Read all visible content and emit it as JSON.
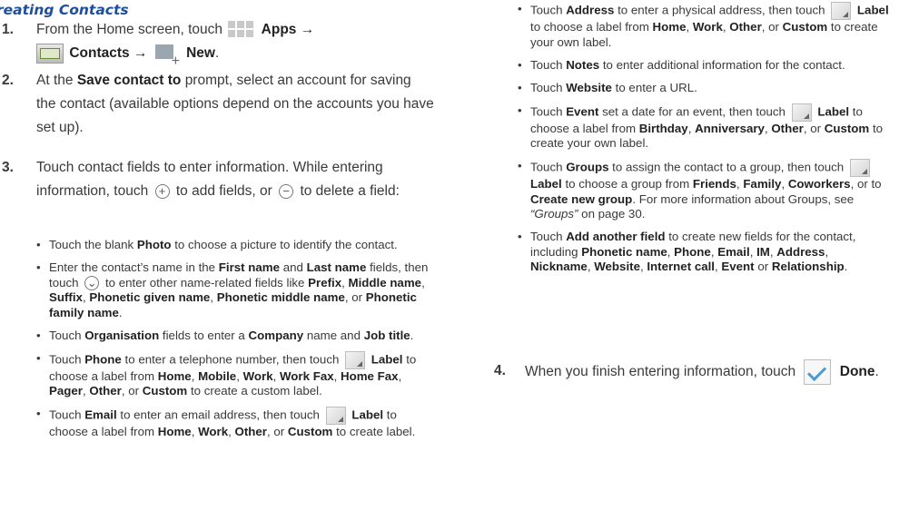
{
  "heading": "reating Contacts",
  "step1": {
    "num": "1.",
    "t_from": "From the Home screen, touch",
    "apps": "Apps",
    "arrow": "→",
    "contacts": "Contacts",
    "new": "New",
    "period": "."
  },
  "step2": {
    "num": "2.",
    "t1": "At the",
    "save": "Save contact to",
    "t2": "prompt, select an account for saving the contact (available options depend on the accounts you have set up)."
  },
  "step3": {
    "num": "3.",
    "t1": "Touch contact fields to enter information. While entering information, touch",
    "t2": "to add fields, or",
    "t3": "to delete a field:"
  },
  "bullets_left": {
    "b1": {
      "t1": "Touch the blank",
      "k1": "Photo",
      "t2": "to choose a picture to identify the contact."
    },
    "b2": {
      "t1": "Enter the contact’s name in the",
      "k1": "First name",
      "t2": "and",
      "k2": "Last name",
      "t3": "fields, then touch",
      "t4": "to enter other name-related fields like",
      "k3": "Prefix",
      "k4": "Middle name",
      "k5": "Suffix",
      "k6": "Phonetic given name",
      "k7": "Phonetic middle name",
      "t5": ", or",
      "k8": "Phonetic family name",
      "t6": "."
    },
    "b3": {
      "t1": "Touch",
      "k1": "Organisation",
      "t2": "fields to enter a",
      "k2": "Company",
      "t3": "name and",
      "k3": "Job title",
      "t4": "."
    },
    "b4": {
      "t1": "Touch",
      "k1": "Phone",
      "t2": "to enter a telephone number, then touch",
      "k2": "Label",
      "t3": "to choose a label from",
      "k3": "Home",
      "k4": "Mobile",
      "k5": "Work",
      "k6": "Work Fax",
      "k7": "Home Fax",
      "k8": "Pager",
      "k9": "Other",
      "t4": ", or",
      "k10": "Custom",
      "t5": "to create a custom label."
    },
    "b5": {
      "t1": "Touch",
      "k1": "Email",
      "t2": "to enter an email address, then touch",
      "k2": "Label",
      "t3": "to choose a label from",
      "k3": "Home",
      "k4": "Work",
      "k5": "Other",
      "t4": ", or",
      "k6": "Custom",
      "t5": "to create label."
    }
  },
  "bullets_right": {
    "b1": {
      "t1": "Touch",
      "k1": "Address",
      "t2": "to enter a physical address, then touch",
      "k2": "Label",
      "t3": "to choose a label from",
      "k3": "Home",
      "k4": "Work",
      "k5": "Other",
      "t4": ", or",
      "k6": "Custom",
      "t5": "to create your own label."
    },
    "b2": {
      "t1": "Touch",
      "k1": "Notes",
      "t2": "to enter additional information for the contact."
    },
    "b3": {
      "t1": "Touch",
      "k1": "Website",
      "t2": "to enter a URL."
    },
    "b4": {
      "t1": "Touch",
      "k1": "Event",
      "t2": "set a date for an event, then touch",
      "k2": "Label",
      "t3": "to choose a label from",
      "k3": "Birthday",
      "k4": "Anniversary",
      "k5": "Other",
      "t4": ", or",
      "k6": "Custom",
      "t5": "to create your own label."
    },
    "b5": {
      "t1": "Touch",
      "k1": "Groups",
      "t2": "to assign the contact to a group, then touch",
      "k2": "Label",
      "t3": "to choose a group from",
      "k3": "Friends",
      "k4": "Family",
      "k5": "Coworkers",
      "t4": ", or to",
      "k6": "Create new group",
      "t5": ". For more information about Groups, see",
      "ref": "“Groups”",
      "t6": "on page 30."
    },
    "b6": {
      "t1": "Touch",
      "k1": "Add another field",
      "t2": "to create new fields for the contact, including",
      "k2": "Phonetic name",
      "k3": "Phone",
      "k4": "Email",
      "k5": "IM",
      "k6": "Address",
      "k7": "Nickname",
      "k8": "Website",
      "k9": "Internet call",
      "k10": "Event",
      "t3": "or",
      "k11": "Relationship",
      "t4": "."
    }
  },
  "step4": {
    "num": "4.",
    "t1": "When you finish entering information, touch",
    "done": "Done",
    "period": "."
  },
  "icons": {
    "apps": "apps-grid-icon",
    "contacts": "contacts-app-icon",
    "new": "new-contact-icon",
    "add": "add-field-icon",
    "remove": "delete-field-icon",
    "expand": "expand-icon",
    "label": "label-dropdown-icon",
    "done": "done-checkmark-icon"
  },
  "colors": {
    "heading": "#1e4f9c",
    "text": "#3a3a3a",
    "checkmark": "#4a9cd6"
  }
}
